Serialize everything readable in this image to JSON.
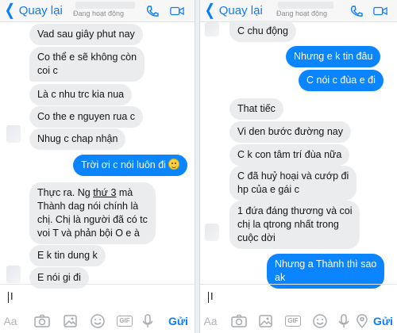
{
  "left": {
    "back_label": "Quay lại",
    "status": "Đang hoạt động",
    "messages": [
      "Vad sau giây phut nay",
      "Co thể e sẽ không còn",
      "coi c",
      "Là c nhu trc kia nua",
      "Co the e nguyen rua c",
      "Nhug c chap nhận",
      "Trời ơi c nói luôn đi",
      "Thực ra. Ng ",
      "thứ 3",
      " mà",
      "Thành dag nói chính là",
      "chị. Chị là người đã có tc",
      "voi T và phản bội O e à",
      "E k tin dung k",
      "E nói gi đi"
    ],
    "input_text": "I",
    "send_label": "Gửi"
  },
  "right": {
    "back_label": "Quay lại",
    "status": "Đang hoạt động",
    "messages": [
      "C chu động",
      "Nhưng e k tin đâu",
      "C nói c đùa e đi",
      "That tiếc",
      "Vi den bước đường nay",
      "C k con tâm trí đùa nữa",
      "C đã huỷ hoại và cướp đi",
      "hp của e gái c",
      "1 đứa đáng thương và coi",
      "chị la qtrong nhất trong",
      "cuộc dời",
      "Nhưng a Thành thì sao",
      "ak"
    ],
    "input_text": "I",
    "send_label": "Gửi"
  },
  "toolbar": {
    "aa_label": "Aa",
    "gif_label": "GIF",
    "icons": [
      "text-size-icon",
      "camera-icon",
      "image-icon",
      "emoji-icon",
      "gif-icon",
      "microphone-icon",
      "location-icon"
    ]
  },
  "colors": {
    "accent": "#0a7cff",
    "outgoing_bubble": "#0a84ff",
    "incoming_bubble": "#ebecee"
  }
}
